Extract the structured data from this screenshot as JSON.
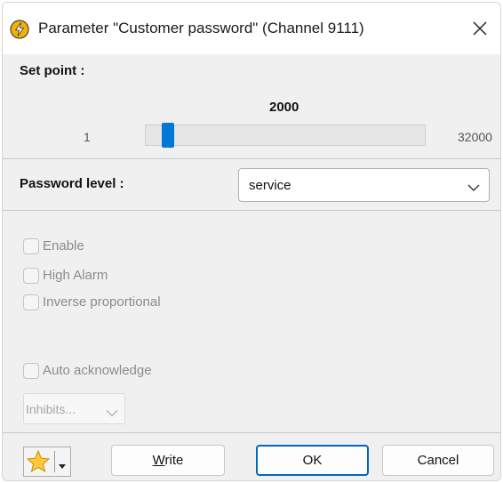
{
  "window": {
    "title": "Parameter \"Customer password\" (Channel 9111)"
  },
  "set_point": {
    "label": "Set point :",
    "value": "2000",
    "min": "1",
    "max": "32000",
    "slider_fraction": 0.0625
  },
  "password_level": {
    "label": "Password level :",
    "selected": "service"
  },
  "checkboxes": [
    {
      "label": "Enable",
      "checked": false,
      "enabled": false
    },
    {
      "label": "High Alarm",
      "checked": false,
      "enabled": false
    },
    {
      "label": "Inverse proportional",
      "checked": false,
      "enabled": false
    },
    {
      "label": "Auto acknowledge",
      "checked": false,
      "enabled": false
    }
  ],
  "inhibits": {
    "label": "Inhibits..."
  },
  "buttons": {
    "write_accel": "W",
    "write_rest": "rite",
    "ok": "OK",
    "cancel": "Cancel"
  },
  "colors": {
    "accent": "#0078d7",
    "dialog_bg": "#f0f0f0",
    "disabled_text": "#8c8c8c"
  },
  "icons": {
    "app": "lightning-bolt-icon",
    "close": "close-icon",
    "dropdown": "chevron-down-icon",
    "favorites": "star-icon"
  }
}
